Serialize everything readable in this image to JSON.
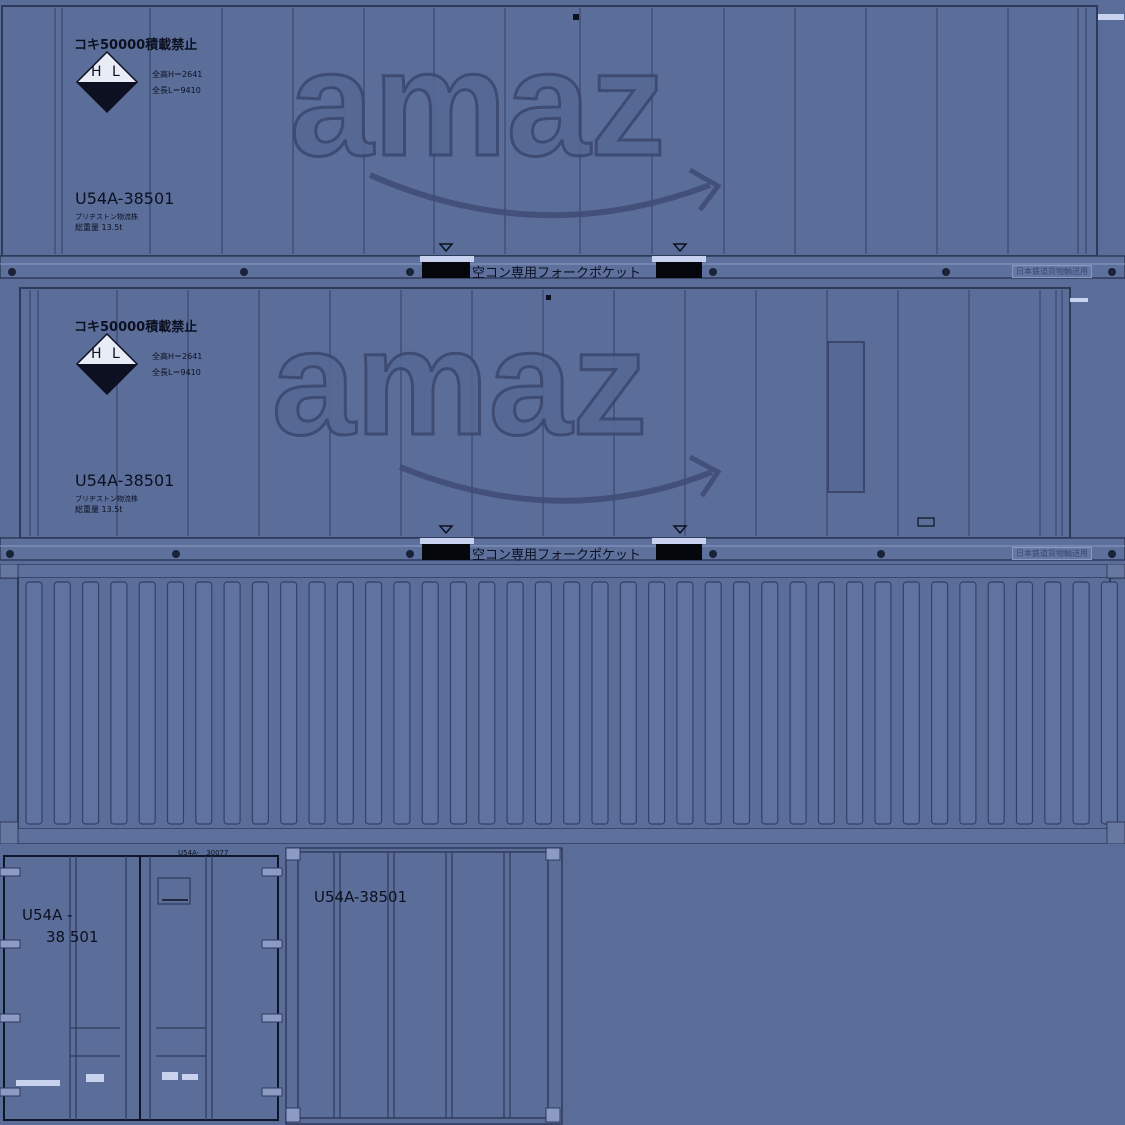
{
  "texture": {
    "colors": {
      "base": "#5a6d99",
      "dark": "#2a3350",
      "light": "#8c9bc4",
      "ink": "#0c1020",
      "pocket": "#05070c"
    },
    "side_panels": [
      {
        "id": "side-a",
        "restriction": "コキ50000積載禁止",
        "hl_sign": {
          "left": "H",
          "right": "L"
        },
        "height_label": "全高H＝2641",
        "length_label": "全長L＝9410",
        "container_number": "U54A-38501",
        "owner": "ブリヂストン物流株",
        "gross_weight": "総重量 13.5t",
        "fork_pocket_label": "空コン専用フォークポケット",
        "jnr_label": "日本鉄道貨物輸送用",
        "logo_icon": "amazon-logo-embossed"
      },
      {
        "id": "side-b",
        "restriction": "コキ50000積載禁止",
        "hl_sign": {
          "left": "H",
          "right": "L"
        },
        "height_label": "全高H＝2641",
        "length_label": "全長L＝9410",
        "container_number": "U54A-38501",
        "owner": "ブリヂストン物流株",
        "gross_weight": "総重量 13.5t",
        "fork_pocket_label": "空コン専用フォークポケット",
        "jnr_label": "日本鉄道貨物輸送用",
        "logo_icon": "amazon-logo-embossed"
      }
    ],
    "roof_panel": {
      "id": "roof",
      "icon": "corrugated-roof"
    },
    "door_end": {
      "top_code": "U54A-　30077",
      "number_line1": "U54A -",
      "number_line2": "38 501"
    },
    "front_end": {
      "container_number": "U54A-38501"
    }
  }
}
